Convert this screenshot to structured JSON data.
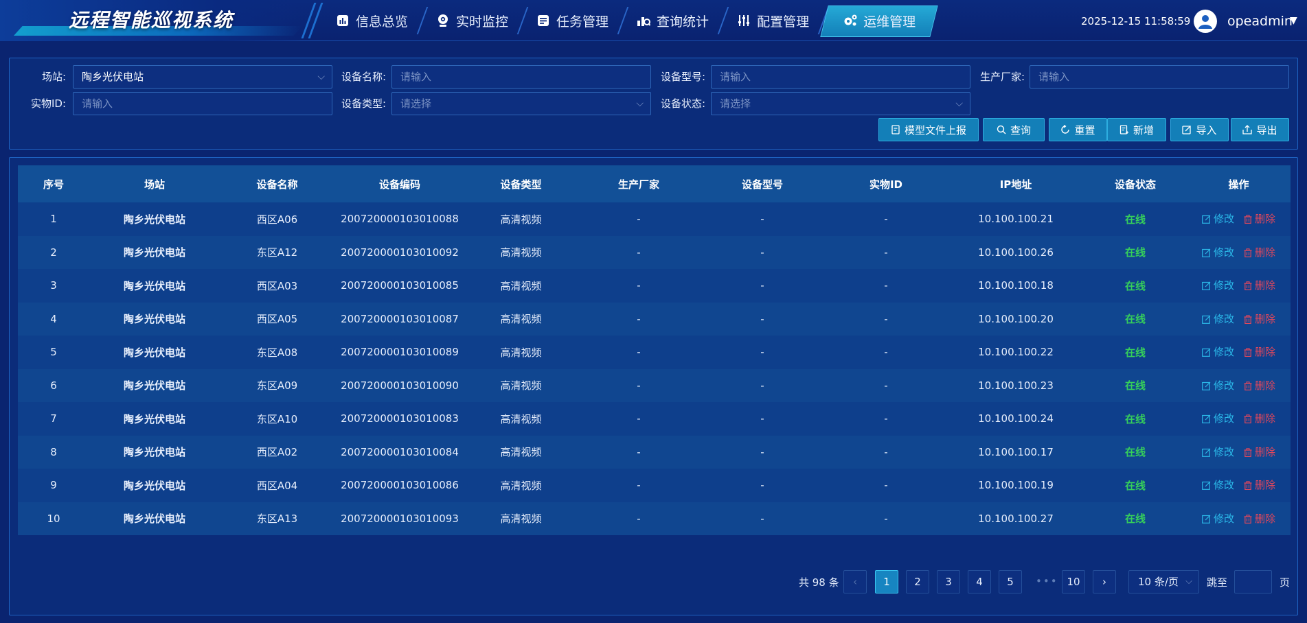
{
  "app": {
    "title": "远程智能巡视系统"
  },
  "nav": {
    "items": [
      {
        "label": "信息总览",
        "icon": "chart-icon"
      },
      {
        "label": "实时监控",
        "icon": "camera-icon"
      },
      {
        "label": "任务管理",
        "icon": "task-icon"
      },
      {
        "label": "查询统计",
        "icon": "stats-icon"
      },
      {
        "label": "配置管理",
        "icon": "sliders-icon"
      },
      {
        "label": "运维管理",
        "icon": "gears-icon",
        "active": true
      }
    ]
  },
  "header": {
    "datetime": "2025-12-15 11:58:59",
    "username": "opeadmin"
  },
  "filters": {
    "site_label": "场站:",
    "site_value": "陶乡光伏电站",
    "device_name_label": "设备名称:",
    "device_name_placeholder": "请输入",
    "device_model_label": "设备型号:",
    "device_model_placeholder": "请输入",
    "manufacturer_label": "生产厂家:",
    "manufacturer_placeholder": "请输入",
    "physical_id_label": "实物ID:",
    "physical_id_placeholder": "请输入",
    "device_type_label": "设备类型:",
    "device_type_placeholder": "请选择",
    "device_status_label": "设备状态:",
    "device_status_placeholder": "请选择"
  },
  "toolbar": {
    "upload_label": "模型文件上报",
    "query_label": "查询",
    "reset_label": "重置",
    "add_label": "新增",
    "import_label": "导入",
    "export_label": "导出"
  },
  "table": {
    "columns": [
      "序号",
      "场站",
      "设备名称",
      "设备编码",
      "设备类型",
      "生产厂家",
      "设备型号",
      "实物ID",
      "IP地址",
      "设备状态",
      "操作"
    ],
    "edit_label": "修改",
    "delete_label": "删除",
    "rows": [
      {
        "no": "1",
        "site": "陶乡光伏电站",
        "name": "西区A06",
        "code": "200720000103010088",
        "type": "高清视频",
        "maker": "-",
        "model": "-",
        "pid": "-",
        "ip": "10.100.100.21",
        "status": "在线"
      },
      {
        "no": "2",
        "site": "陶乡光伏电站",
        "name": "东区A12",
        "code": "200720000103010092",
        "type": "高清视频",
        "maker": "-",
        "model": "-",
        "pid": "-",
        "ip": "10.100.100.26",
        "status": "在线"
      },
      {
        "no": "3",
        "site": "陶乡光伏电站",
        "name": "西区A03",
        "code": "200720000103010085",
        "type": "高清视频",
        "maker": "-",
        "model": "-",
        "pid": "-",
        "ip": "10.100.100.18",
        "status": "在线"
      },
      {
        "no": "4",
        "site": "陶乡光伏电站",
        "name": "西区A05",
        "code": "200720000103010087",
        "type": "高清视频",
        "maker": "-",
        "model": "-",
        "pid": "-",
        "ip": "10.100.100.20",
        "status": "在线"
      },
      {
        "no": "5",
        "site": "陶乡光伏电站",
        "name": "东区A08",
        "code": "200720000103010089",
        "type": "高清视频",
        "maker": "-",
        "model": "-",
        "pid": "-",
        "ip": "10.100.100.22",
        "status": "在线"
      },
      {
        "no": "6",
        "site": "陶乡光伏电站",
        "name": "东区A09",
        "code": "200720000103010090",
        "type": "高清视频",
        "maker": "-",
        "model": "-",
        "pid": "-",
        "ip": "10.100.100.23",
        "status": "在线"
      },
      {
        "no": "7",
        "site": "陶乡光伏电站",
        "name": "东区A10",
        "code": "200720000103010083",
        "type": "高清视频",
        "maker": "-",
        "model": "-",
        "pid": "-",
        "ip": "10.100.100.24",
        "status": "在线"
      },
      {
        "no": "8",
        "site": "陶乡光伏电站",
        "name": "西区A02",
        "code": "200720000103010084",
        "type": "高清视频",
        "maker": "-",
        "model": "-",
        "pid": "-",
        "ip": "10.100.100.17",
        "status": "在线"
      },
      {
        "no": "9",
        "site": "陶乡光伏电站",
        "name": "西区A04",
        "code": "200720000103010086",
        "type": "高清视频",
        "maker": "-",
        "model": "-",
        "pid": "-",
        "ip": "10.100.100.19",
        "status": "在线"
      },
      {
        "no": "10",
        "site": "陶乡光伏电站",
        "name": "东区A13",
        "code": "200720000103010093",
        "type": "高清视频",
        "maker": "-",
        "model": "-",
        "pid": "-",
        "ip": "10.100.100.27",
        "status": "在线"
      }
    ]
  },
  "pagination": {
    "total_text": "共 98 条",
    "pages": [
      "1",
      "2",
      "3",
      "4",
      "5",
      "10"
    ],
    "current": "1",
    "ellipsis": "•••",
    "prev": "‹",
    "next": "›",
    "page_size": "10 条/页",
    "jump_label": "跳至",
    "jump_unit": "页"
  },
  "colors": {
    "background": "#0a2470",
    "accent": "#137fb8",
    "status_online": "#36d05a",
    "edit": "#2bb8e8",
    "delete": "#e0475c"
  }
}
